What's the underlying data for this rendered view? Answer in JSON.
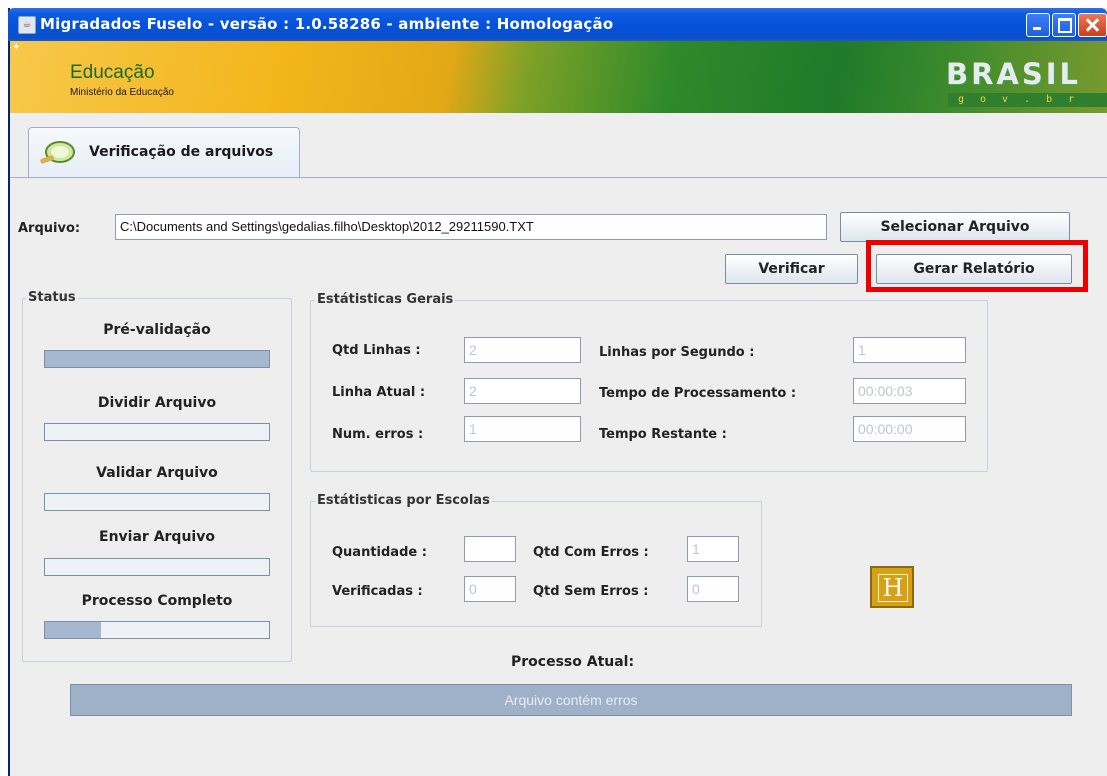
{
  "window": {
    "title": "Migradados Fuselo - versão : 1.0.58286 - ambiente : Homologação"
  },
  "banner": {
    "org": "Educação",
    "ministry": "Ministério da Educação",
    "brand": "BRASIL",
    "brand_sub": "gov.br"
  },
  "tab": {
    "label": "Verificação de arquivos"
  },
  "file": {
    "label": "Arquivo:",
    "path": "C:\\Documents and Settings\\gedalias.filho\\Desktop\\2012_29211590.TXT",
    "select_button": "Selecionar Arquivo",
    "verify_button": "Verificar",
    "report_button": "Gerar Relatório"
  },
  "status": {
    "title": "Status",
    "steps": [
      {
        "label": "Pré-validação",
        "progress": 1.0
      },
      {
        "label": "Dividir Arquivo",
        "progress": 0
      },
      {
        "label": "Validar Arquivo",
        "progress": 0
      },
      {
        "label": "Enviar Arquivo",
        "progress": 0
      },
      {
        "label": "Processo Completo",
        "progress": 0.25
      }
    ]
  },
  "general_stats": {
    "title": "Estátisticas Gerais",
    "qtd_linhas_label": "Qtd Linhas :",
    "qtd_linhas": "2",
    "linha_atual_label": "Linha Atual :",
    "linha_atual": "2",
    "num_erros_label": "Num. erros :",
    "num_erros": "1",
    "linhas_seg_label": "Linhas por Segundo :",
    "linhas_seg": "1",
    "tempo_proc_label": "Tempo de Processamento :",
    "tempo_proc": "00:00:03",
    "tempo_rest_label": "Tempo Restante :",
    "tempo_rest": "00:00:00"
  },
  "school_stats": {
    "title": "Estátisticas por Escolas",
    "quantidade_label": "Quantidade :",
    "quantidade": "",
    "verificadas_label": "Verificadas :",
    "verificadas": "0",
    "com_erros_label": "Qtd Com Erros :",
    "com_erros": "1",
    "sem_erros_label": "Qtd Sem Erros :",
    "sem_erros": "0"
  },
  "process": {
    "label": "Processo Atual:",
    "message": "Arquivo contém erros"
  },
  "help_icon": {
    "letter": "H"
  }
}
